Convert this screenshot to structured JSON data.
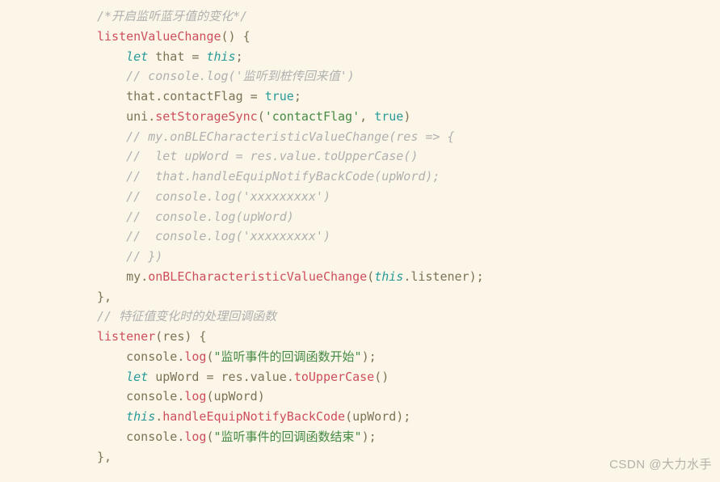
{
  "lines": [
    {
      "indent": 0,
      "tokens": [
        {
          "cls": "cmt",
          "t": "/*开启监听蓝牙值的变化*/"
        }
      ]
    },
    {
      "indent": 0,
      "tokens": [
        {
          "cls": "fn",
          "t": "listenValueChange"
        },
        {
          "cls": "pn",
          "t": "() {"
        }
      ]
    },
    {
      "indent": 1,
      "tokens": [
        {
          "cls": "kw",
          "t": "let"
        },
        {
          "cls": "id",
          "t": " that "
        },
        {
          "cls": "pn",
          "t": "= "
        },
        {
          "cls": "this",
          "t": "this"
        },
        {
          "cls": "pn",
          "t": ";"
        }
      ]
    },
    {
      "indent": 1,
      "tokens": [
        {
          "cls": "cmt",
          "t": "// console.log('监听到桩传回来值')"
        }
      ]
    },
    {
      "indent": 1,
      "tokens": [
        {
          "cls": "id",
          "t": "that"
        },
        {
          "cls": "pn",
          "t": "."
        },
        {
          "cls": "id",
          "t": "contactFlag "
        },
        {
          "cls": "pn",
          "t": "= "
        },
        {
          "cls": "bool",
          "t": "true"
        },
        {
          "cls": "pn",
          "t": ";"
        }
      ]
    },
    {
      "indent": 1,
      "tokens": [
        {
          "cls": "id",
          "t": "uni"
        },
        {
          "cls": "pn",
          "t": "."
        },
        {
          "cls": "fn",
          "t": "setStorageSync"
        },
        {
          "cls": "pn",
          "t": "("
        },
        {
          "cls": "str",
          "t": "'contactFlag'"
        },
        {
          "cls": "pn",
          "t": ", "
        },
        {
          "cls": "bool",
          "t": "true"
        },
        {
          "cls": "pn",
          "t": ")"
        }
      ]
    },
    {
      "indent": 1,
      "tokens": [
        {
          "cls": "cmt",
          "t": "// my.onBLECharacteristicValueChange(res => {"
        }
      ]
    },
    {
      "indent": 1,
      "tokens": [
        {
          "cls": "cmt",
          "t": "//  let upWord = res.value.toUpperCase()"
        }
      ]
    },
    {
      "indent": 1,
      "tokens": [
        {
          "cls": "cmt",
          "t": "//  that.handleEquipNotifyBackCode(upWord);"
        }
      ]
    },
    {
      "indent": 1,
      "tokens": [
        {
          "cls": "cmt",
          "t": "//  console.log('xxxxxxxxx')"
        }
      ]
    },
    {
      "indent": 1,
      "tokens": [
        {
          "cls": "cmt",
          "t": "//  console.log(upWord)"
        }
      ]
    },
    {
      "indent": 1,
      "tokens": [
        {
          "cls": "cmt",
          "t": "//  console.log('xxxxxxxxx')"
        }
      ]
    },
    {
      "indent": 1,
      "tokens": [
        {
          "cls": "cmt",
          "t": "// })"
        }
      ]
    },
    {
      "indent": 1,
      "tokens": [
        {
          "cls": "id",
          "t": "my"
        },
        {
          "cls": "pn",
          "t": "."
        },
        {
          "cls": "fn",
          "t": "onBLECharacteristicValueChange"
        },
        {
          "cls": "pn",
          "t": "("
        },
        {
          "cls": "this",
          "t": "this"
        },
        {
          "cls": "pn",
          "t": "."
        },
        {
          "cls": "id",
          "t": "listener"
        },
        {
          "cls": "pn",
          "t": ");"
        }
      ]
    },
    {
      "indent": 0,
      "tokens": [
        {
          "cls": "pn",
          "t": "},"
        }
      ]
    },
    {
      "indent": 0,
      "tokens": [
        {
          "cls": "cmt",
          "t": "// 特征值变化时的处理回调函数"
        }
      ]
    },
    {
      "indent": 0,
      "tokens": [
        {
          "cls": "fn",
          "t": "listener"
        },
        {
          "cls": "pn",
          "t": "("
        },
        {
          "cls": "id",
          "t": "res"
        },
        {
          "cls": "pn",
          "t": ") {"
        }
      ]
    },
    {
      "indent": 1,
      "tokens": [
        {
          "cls": "id",
          "t": "console"
        },
        {
          "cls": "pn",
          "t": "."
        },
        {
          "cls": "fn",
          "t": "log"
        },
        {
          "cls": "pn",
          "t": "("
        },
        {
          "cls": "str",
          "t": "\"监听事件的回调函数开始\""
        },
        {
          "cls": "pn",
          "t": ");"
        }
      ]
    },
    {
      "indent": 1,
      "tokens": [
        {
          "cls": "kw",
          "t": "let"
        },
        {
          "cls": "id",
          "t": " upWord "
        },
        {
          "cls": "pn",
          "t": "= "
        },
        {
          "cls": "id",
          "t": "res"
        },
        {
          "cls": "pn",
          "t": "."
        },
        {
          "cls": "id",
          "t": "value"
        },
        {
          "cls": "pn",
          "t": "."
        },
        {
          "cls": "fn",
          "t": "toUpperCase"
        },
        {
          "cls": "pn",
          "t": "()"
        }
      ]
    },
    {
      "indent": 1,
      "tokens": [
        {
          "cls": "id",
          "t": "console"
        },
        {
          "cls": "pn",
          "t": "."
        },
        {
          "cls": "fn",
          "t": "log"
        },
        {
          "cls": "pn",
          "t": "("
        },
        {
          "cls": "id",
          "t": "upWord"
        },
        {
          "cls": "pn",
          "t": ")"
        }
      ]
    },
    {
      "indent": 1,
      "tokens": [
        {
          "cls": "this",
          "t": "this"
        },
        {
          "cls": "pn",
          "t": "."
        },
        {
          "cls": "fn",
          "t": "handleEquipNotifyBackCode"
        },
        {
          "cls": "pn",
          "t": "("
        },
        {
          "cls": "id",
          "t": "upWord"
        },
        {
          "cls": "pn",
          "t": ");"
        }
      ]
    },
    {
      "indent": 1,
      "tokens": [
        {
          "cls": "id",
          "t": "console"
        },
        {
          "cls": "pn",
          "t": "."
        },
        {
          "cls": "fn",
          "t": "log"
        },
        {
          "cls": "pn",
          "t": "("
        },
        {
          "cls": "str",
          "t": "\"监听事件的回调函数结束\""
        },
        {
          "cls": "pn",
          "t": ");"
        }
      ]
    },
    {
      "indent": 0,
      "tokens": [
        {
          "cls": "pn",
          "t": "},"
        }
      ]
    }
  ],
  "watermark": "CSDN @大力水手"
}
